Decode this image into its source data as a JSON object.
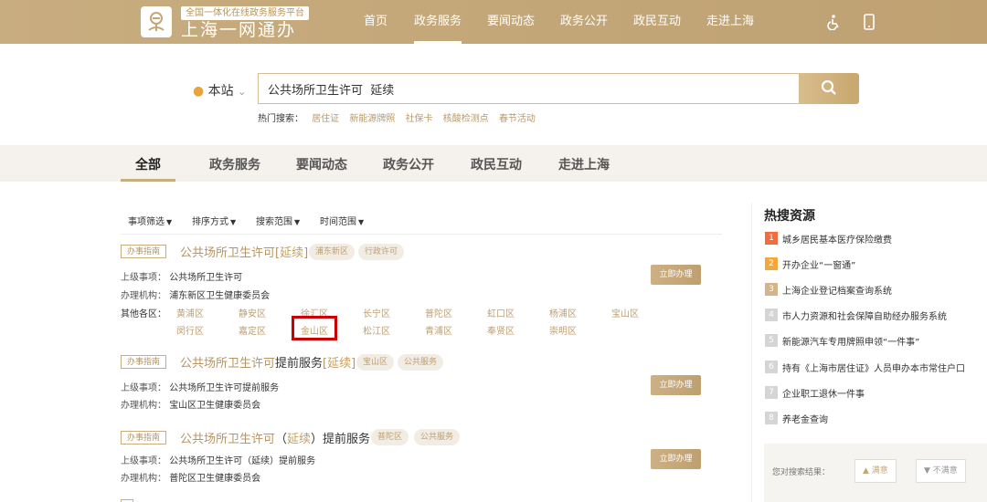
{
  "header": {
    "slogan": "全国一体化在线政务服务平台",
    "brand": "上海一网通办",
    "nav": [
      "首页",
      "政务服务",
      "要闻动态",
      "政务公开",
      "政民互动",
      "走进上海"
    ],
    "active_nav": "政务服务",
    "icons": [
      "logo-icon",
      "accessibility-icon",
      "mobile-icon"
    ]
  },
  "search": {
    "location_label": "本站",
    "query": "公共场所卫生许可  延续",
    "hot_label": "热门搜索：",
    "hot_terms": [
      "居住证",
      "新能源牌照",
      "社保卡",
      "核酸检测点",
      "春节活动"
    ]
  },
  "tabs": [
    "全部",
    "政务服务",
    "要闻动态",
    "政务公开",
    "政民互动",
    "走进上海"
  ],
  "active_tab": "全部",
  "filters": [
    "事项筛选",
    "排序方式",
    "搜索范围",
    "时间范围"
  ],
  "results": [
    {
      "tag": "办事指南",
      "title_parts": [
        {
          "t": "公共场所卫生许可[",
          "h": true
        },
        {
          "t": "延续",
          "h": true
        },
        {
          "t": "]",
          "h": true
        }
      ],
      "pills": [
        "浦东新区",
        "行政许可"
      ],
      "upper_label": "上级事项：",
      "upper": "公共场所卫生许可",
      "org_label": "办理机构：",
      "org": "浦东新区卫生健康委员会",
      "other_label": "其他各区：",
      "districts": [
        "黄浦区",
        "静安区",
        "徐汇区",
        "长宁区",
        "普陀区",
        "虹口区",
        "杨浦区",
        "宝山区",
        "闵行区",
        "嘉定区",
        "金山区",
        "松江区",
        "青浦区",
        "奉贤区",
        "崇明区"
      ],
      "button": "立即办理"
    },
    {
      "tag": "办事指南",
      "title_parts": [
        {
          "t": "公共场所卫生许可",
          "h": true
        },
        {
          "t": "提前服务",
          "h": false
        },
        {
          "t": "[延续]",
          "h": true
        }
      ],
      "pills": [
        "宝山区",
        "公共服务"
      ],
      "upper_label": "上级事项：",
      "upper": "公共场所卫生许可提前服务",
      "org_label": "办理机构：",
      "org": "宝山区卫生健康委员会",
      "button": "立即办理"
    },
    {
      "tag": "办事指南",
      "title_parts": [
        {
          "t": "公共场所卫生许可",
          "h": true
        },
        {
          "t": "（",
          "h": false
        },
        {
          "t": "延续",
          "h": true
        },
        {
          "t": "）提前服务",
          "h": false
        }
      ],
      "pills": [
        "普陀区",
        "公共服务"
      ],
      "upper_label": "上级事项：",
      "upper": "公共场所卫生许可（延续）提前服务",
      "org_label": "办理机构：",
      "org": "普陀区卫生健康委员会",
      "button": "立即办理"
    }
  ],
  "sidebar": {
    "title": "热搜资源",
    "items": [
      "城乡居民基本医疗保险缴费",
      "开办企业“一窗通”",
      "上海企业登记档案查询系统",
      "市人力资源和社会保障自助经办服务系统",
      "新能源汽车专用牌照申领“一件事”",
      "持有《上海市居住证》人员申办本市常住户口",
      "企业职工退休一件事",
      "养老金查询"
    ],
    "feedback_label": "您对搜索结果：",
    "satisfied": "满意",
    "unsatisfied": "不满意"
  },
  "colors": {
    "header": "#c4a777",
    "accent_text": "#b89462",
    "highlight_box": "#cc0000"
  }
}
